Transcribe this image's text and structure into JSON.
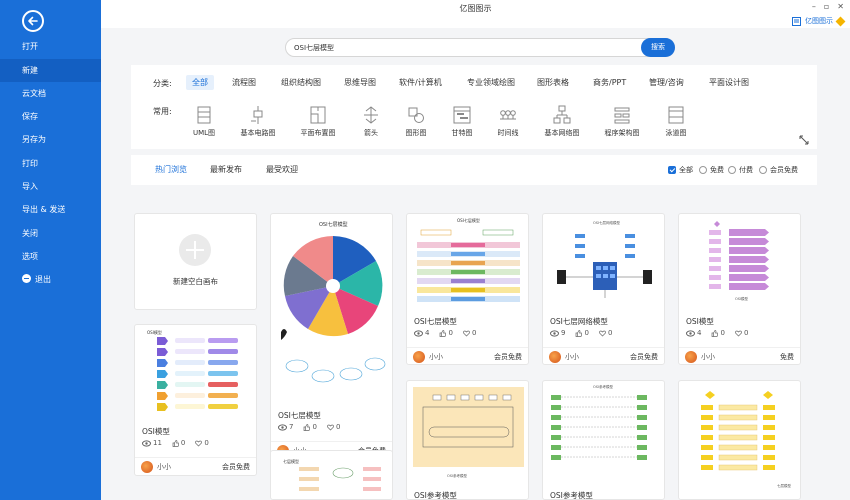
{
  "window": {
    "title": "亿图图示",
    "controls": [
      "–",
      "▫",
      "✕"
    ]
  },
  "brand": {
    "label": "亿图图示"
  },
  "sidebar": {
    "items": [
      {
        "id": "open",
        "label": "打开"
      },
      {
        "id": "new",
        "label": "新建",
        "active": true
      },
      {
        "id": "cloud",
        "label": "云文档"
      },
      {
        "id": "save",
        "label": "保存"
      },
      {
        "id": "saveas",
        "label": "另存为"
      },
      {
        "id": "print",
        "label": "打印"
      },
      {
        "id": "import",
        "label": "导入"
      },
      {
        "id": "export",
        "label": "导出 & 发送"
      },
      {
        "id": "close",
        "label": "关闭"
      },
      {
        "id": "options",
        "label": "选项"
      },
      {
        "id": "exit",
        "label": "退出"
      }
    ]
  },
  "search": {
    "value": "OSI七层模型",
    "button": "搜索"
  },
  "categories": {
    "label": "分类:",
    "items": [
      "全部",
      "流程图",
      "组织结构图",
      "思维导图",
      "软件/计算机",
      "专业领域绘图",
      "图形表格",
      "商务/PPT",
      "管理/咨询",
      "平面设计图"
    ],
    "active_index": 0
  },
  "common": {
    "label": "常用:",
    "items": [
      "UML图",
      "基本电路图",
      "平面布置图",
      "箭头",
      "图形图",
      "甘特图",
      "时间线",
      "基本网络图",
      "程序架构图",
      "泳道图"
    ]
  },
  "tabs": {
    "items": [
      "热门浏览",
      "最新发布",
      "最受欢迎"
    ],
    "active_index": 0
  },
  "filters": [
    {
      "label": "全部",
      "checked": true
    },
    {
      "label": "免费",
      "checked": false
    },
    {
      "label": "付费",
      "checked": false
    },
    {
      "label": "会员免费",
      "checked": false
    }
  ],
  "new_blank": {
    "label": "新建空白画布"
  },
  "cards": [
    {
      "id": "c1",
      "title": "OSI模型",
      "views": "11",
      "likes": "0",
      "favs": "0",
      "author": "小小",
      "license": "会员免费",
      "thumb_title": "OSI模型"
    },
    {
      "id": "c2",
      "title": "OSI七层模型",
      "views": "7",
      "likes": "0",
      "favs": "0",
      "author": "小小",
      "license": "会员免费",
      "thumb_title": "OSI七层模型"
    },
    {
      "id": "c3",
      "title": "OSI七层模型",
      "views": "4",
      "likes": "0",
      "favs": "0",
      "author": "小小",
      "license": "会员免费",
      "thumb_title": "OSI七层模型"
    },
    {
      "id": "c4",
      "title": "OSI七层网络模型",
      "views": "9",
      "likes": "0",
      "favs": "0",
      "author": "小小",
      "license": "会员免费",
      "thumb_title": "OSI七层网络模型"
    },
    {
      "id": "c5",
      "title": "OSI模型",
      "views": "4",
      "likes": "0",
      "favs": "0",
      "author": "小小",
      "license": "免费",
      "thumb_title": "OSI模型"
    },
    {
      "id": "c6",
      "title": "OSI参考模型",
      "thumb_title": "OSI参考模型"
    },
    {
      "id": "c7",
      "title": "OSI参考模型",
      "thumb_title": "OSI参考模型"
    },
    {
      "id": "c8",
      "thumb_title": "七层模型"
    },
    {
      "id": "c9",
      "thumb_title": "七层模型"
    }
  ],
  "colors": {
    "primary": "#1a6fd8",
    "sidebar": "#1a6fd8",
    "active_side": "#135fc2"
  }
}
